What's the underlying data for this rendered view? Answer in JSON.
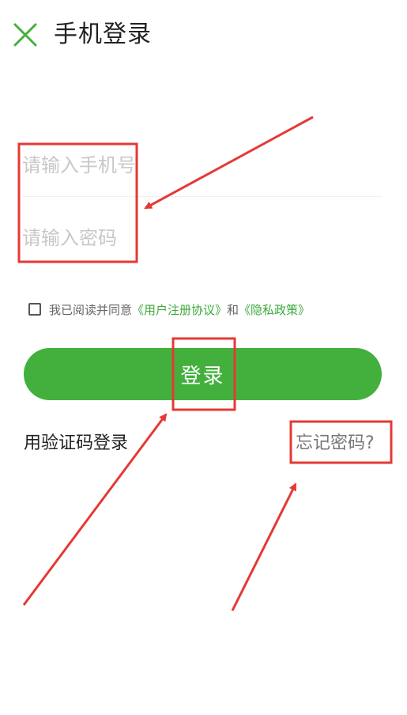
{
  "header": {
    "title": "手机登录",
    "close_icon": "close-icon"
  },
  "form": {
    "phone_placeholder": "请输入手机号",
    "password_placeholder": "请输入密码"
  },
  "agreement": {
    "prefix": "我已阅读并同意",
    "user_agreement": "《用户注册协议》",
    "conjunction": "和",
    "privacy_policy": "《隐私政策》",
    "checked": false
  },
  "actions": {
    "login_label": "登录",
    "sms_login_label": "用验证码登录",
    "forgot_password_label": "忘记密码?"
  },
  "colors": {
    "accent": "#43b03d",
    "link": "#3ba93a",
    "annotation": "#e53935"
  }
}
